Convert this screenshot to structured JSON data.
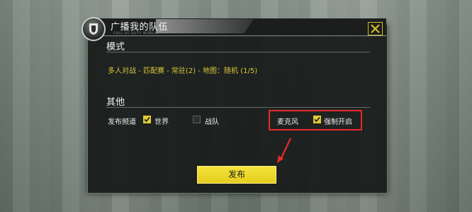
{
  "dialog": {
    "title": "广播我的队伍",
    "subtitle": "CALL OF DUTY MOBILE"
  },
  "mode": {
    "heading": "模式",
    "value": "多人对战 - 匹配赛 - 常驻(2) - 地图：随机 (1/5)"
  },
  "other": {
    "heading": "其他",
    "channel_label": "发布频道",
    "world_label": "世界",
    "world_checked": true,
    "clan_label": "战队",
    "clan_checked": false,
    "mic_label": "麦克风",
    "force_open_label": "强制开启",
    "force_open_checked": true
  },
  "publish_button": "发布",
  "icons": {
    "emblem": "codm-emblem-icon",
    "close": "close-icon",
    "check": "check-icon"
  },
  "colors": {
    "accent_yellow": "#e1cc34",
    "highlight_red": "#e52b2b",
    "panel_bg": "#161918"
  }
}
